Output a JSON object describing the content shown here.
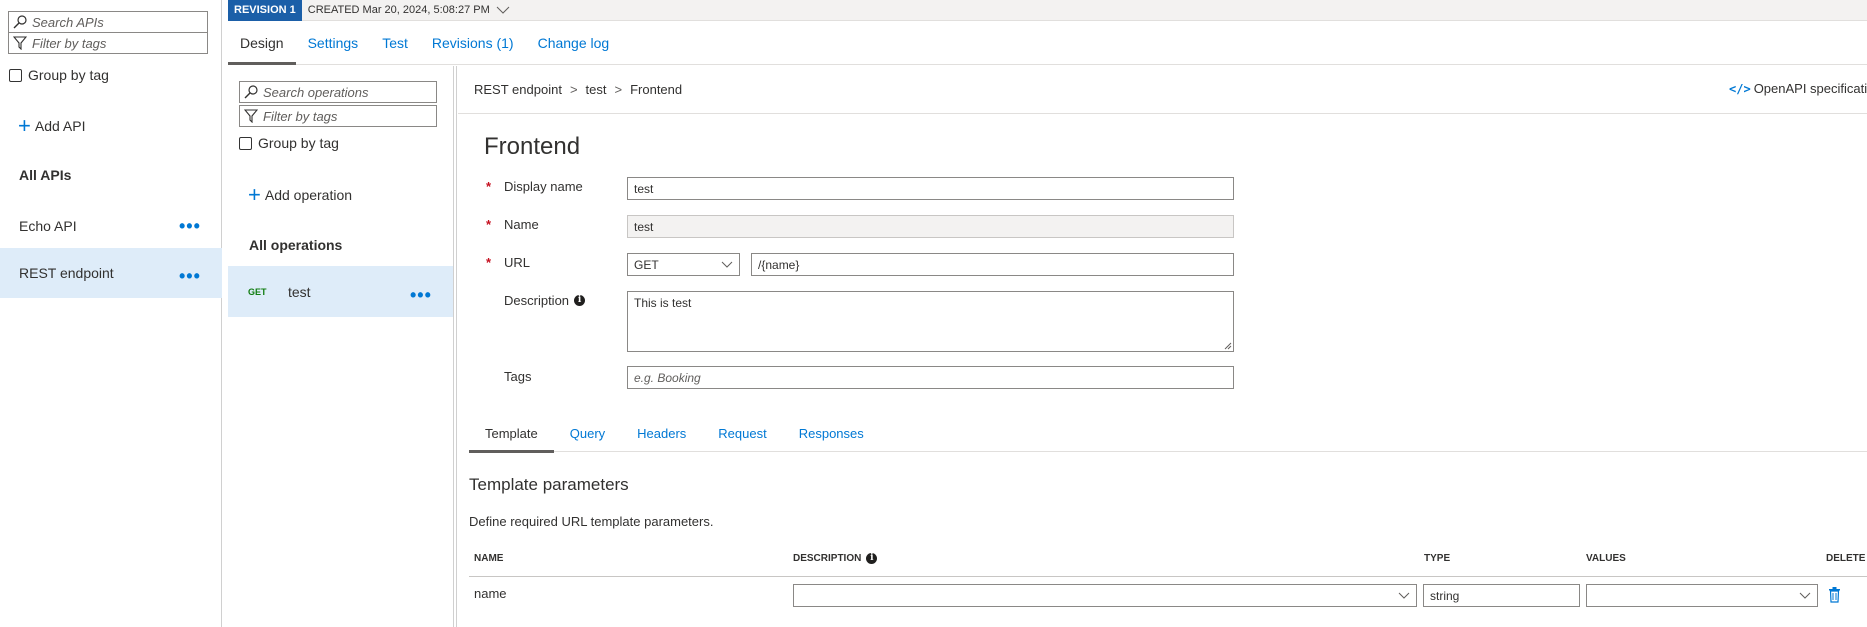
{
  "api_pane": {
    "search_placeholder": "Search APIs",
    "filter_placeholder": "Filter by tags",
    "group_by_tag": "Group by tag",
    "add_api": "Add API",
    "all_apis": "All APIs",
    "items": [
      {
        "label": "Echo API",
        "selected": false
      },
      {
        "label": "REST endpoint",
        "selected": true
      }
    ]
  },
  "revision": {
    "badge": "REVISION 1",
    "created": "CREATED Mar 20, 2024, 5:08:27 PM"
  },
  "top_tabs": [
    "Design",
    "Settings",
    "Test",
    "Revisions (1)",
    "Change log"
  ],
  "ops_pane": {
    "search_placeholder": "Search operations",
    "filter_placeholder": "Filter by tags",
    "group_by_tag": "Group by tag",
    "add_operation": "Add operation",
    "all_operations": "All operations",
    "operations": [
      {
        "method": "GET",
        "name": "test",
        "selected": true
      }
    ]
  },
  "breadcrumb": [
    "REST endpoint",
    "test",
    "Frontend"
  ],
  "openapi_link": "OpenAPI specificatio",
  "form": {
    "title": "Frontend",
    "display_name_label": "Display name",
    "display_name_value": "test",
    "name_label": "Name",
    "name_value": "test",
    "url_label": "URL",
    "url_method": "GET",
    "url_template": "/{name}",
    "description_label": "Description",
    "description_value": "This is test",
    "tags_label": "Tags",
    "tags_placeholder": "e.g. Booking"
  },
  "sub_tabs": [
    "Template",
    "Query",
    "Headers",
    "Request",
    "Responses"
  ],
  "template_params": {
    "title": "Template parameters",
    "description": "Define required URL template parameters.",
    "columns": [
      "NAME",
      "DESCRIPTION",
      "TYPE",
      "VALUES",
      "DELETE"
    ],
    "rows": [
      {
        "name": "name",
        "description": "",
        "type": "string",
        "values": ""
      }
    ]
  },
  "colors": {
    "accent": "#0078d4",
    "revision_badge": "#1b5fa8",
    "selected_row": "#deecf9",
    "required": "#c50f1f",
    "get_method": "#107c10"
  }
}
